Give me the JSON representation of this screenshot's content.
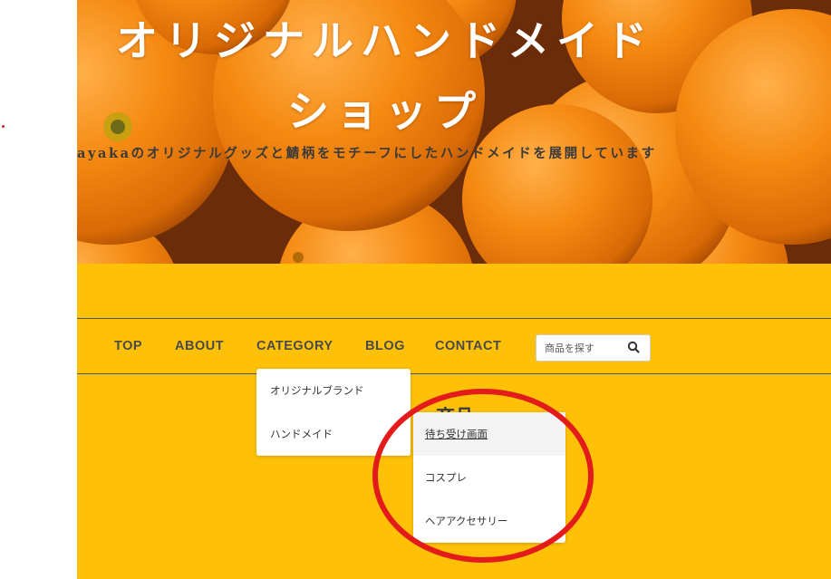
{
  "header": {
    "title": "オリジナルハンドメイド\nショップ",
    "tagline": "ayakaのオリジナルグッズと鯖柄をモチーフにしたハンドメイドを展開しています"
  },
  "nav": {
    "items": [
      {
        "label": "TOP"
      },
      {
        "label": "ABOUT"
      },
      {
        "label": "CATEGORY"
      },
      {
        "label": "BLOG"
      },
      {
        "label": "CONTACT"
      }
    ],
    "search": {
      "placeholder": "商品を探す",
      "icon": "search-icon"
    }
  },
  "main": {
    "heading_partial": "商品"
  },
  "category_menu": {
    "items": [
      {
        "label": "オリジナルブランド"
      },
      {
        "label": "ハンドメイド"
      }
    ]
  },
  "handmade_submenu": {
    "items": [
      {
        "label": "待ち受け画面",
        "hovered": true
      },
      {
        "label": "コスプレ"
      },
      {
        "label": "ヘアアクセサリー"
      }
    ]
  },
  "colors": {
    "page_background": "#ffc107",
    "nav_text": "#4a4a4a",
    "annotation_circle": "#e31b1b",
    "title_text": "#ffffff"
  }
}
